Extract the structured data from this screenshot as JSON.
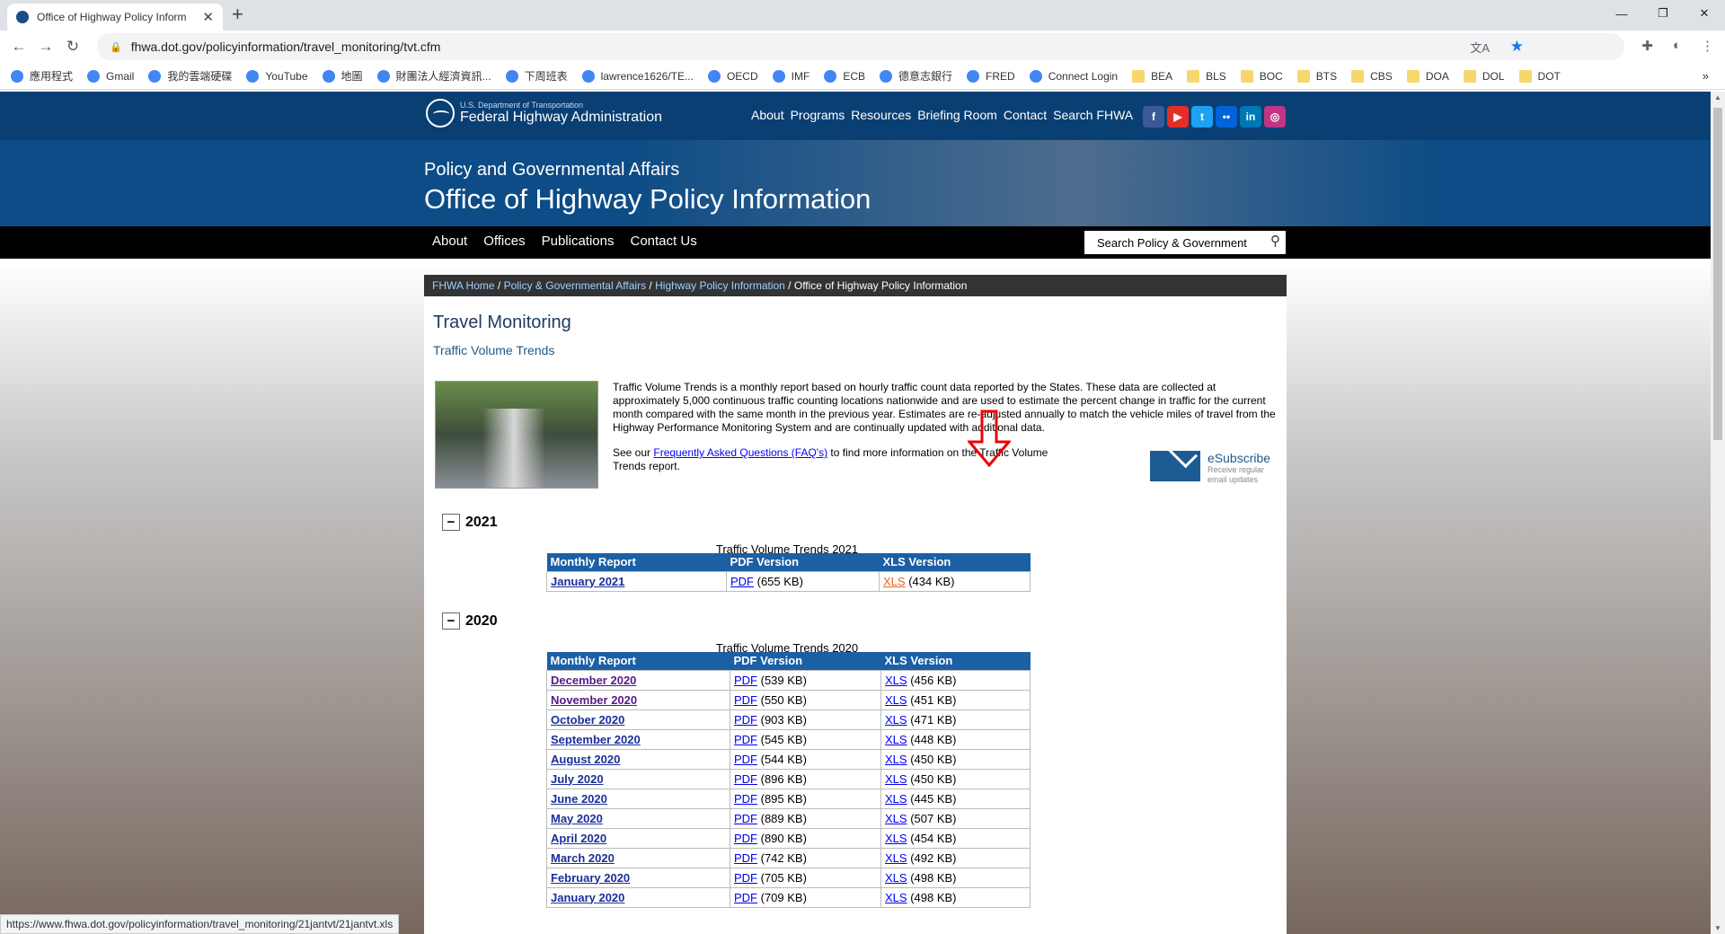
{
  "browser": {
    "tab_title": "Office of Highway Policy Inform",
    "url": "fhwa.dot.gov/policyinformation/travel_monitoring/tvt.cfm",
    "bookmarks": [
      "應用程式",
      "Gmail",
      "我的雲端硬碟",
      "YouTube",
      "地圖",
      "財團法人經濟資訊...",
      "下周班表",
      "lawrence1626/TE...",
      "OECD",
      "IMF",
      "ECB",
      "德意志銀行",
      "FRED",
      "Connect Login",
      "BEA",
      "BLS",
      "BOC",
      "BTS",
      "CBS",
      "DOA",
      "DOL",
      "DOT"
    ],
    "status_url": "https://www.fhwa.dot.gov/policyinformation/travel_monitoring/21jantvt/21jantvt.xls"
  },
  "header": {
    "agency_line1": "U.S. Department of Transportation",
    "agency_line2": "Federal Highway Administration",
    "nav": [
      "About",
      "Programs",
      "Resources",
      "Briefing Room",
      "Contact",
      "Search FHWA"
    ],
    "social": [
      {
        "label": "f",
        "color": "#3b5998"
      },
      {
        "label": "▶",
        "color": "#e52d27"
      },
      {
        "label": "t",
        "color": "#1da1f2"
      },
      {
        "label": "••",
        "color": "#0063dc"
      },
      {
        "label": "in",
        "color": "#0077b5"
      },
      {
        "label": "◎",
        "color": "#c13584"
      }
    ],
    "banner_sub": "Policy and Governmental Affairs",
    "banner_title": "Office of Highway Policy Information",
    "subnav": [
      "About",
      "Offices",
      "Publications",
      "Contact Us"
    ],
    "search_placeholder": "Search Policy & Government"
  },
  "breadcrumb": {
    "links": [
      "FHWA Home",
      "Policy & Governmental Affairs",
      "Highway Policy Information"
    ],
    "current": "Office of Highway Policy Information"
  },
  "main": {
    "title": "Travel Monitoring",
    "subtitle": "Traffic Volume Trends",
    "intro": "Traffic Volume Trends is a monthly report based on hourly traffic count data reported by the States. These data are collected at approximately 5,000 continuous traffic counting locations nationwide and are used to estimate the percent change in traffic for the current month compared with the same month in the previous year. Estimates are re-adjusted annually to match the vehicle miles of travel from the Highway Performance Monitoring System and are continually updated with additional data.",
    "faq_pre": "See our ",
    "faq_link": "Frequently Asked Questions (FAQ's)",
    "faq_post": " to find more information on the Traffic Volume Trends report.",
    "esubscribe": "eSubscribe",
    "esubscribe_sub": "Receive regular email updates"
  },
  "sections": [
    {
      "year": "2021",
      "caption": "Traffic Volume Trends 2021",
      "headers": [
        "Monthly Report",
        "PDF Version",
        "XLS Version"
      ],
      "rows": [
        {
          "month": "January 2021",
          "pdf": "PDF",
          "pdf_size": " (655 KB)",
          "xls": "XLS",
          "xls_size": " (434 KB)"
        }
      ]
    },
    {
      "year": "2020",
      "caption": "Traffic Volume Trends 2020",
      "headers": [
        "Monthly Report",
        "PDF Version",
        "XLS Version"
      ],
      "rows": [
        {
          "month": "December 2020",
          "pdf": "PDF",
          "pdf_size": " (539 KB)",
          "xls": "XLS",
          "xls_size": " (456 KB)"
        },
        {
          "month": "November 2020",
          "pdf": "PDF",
          "pdf_size": " (550 KB)",
          "xls": "XLS",
          "xls_size": " (451 KB)"
        },
        {
          "month": "October 2020",
          "pdf": "PDF",
          "pdf_size": " (903 KB)",
          "xls": "XLS",
          "xls_size": " (471 KB)"
        },
        {
          "month": "September 2020",
          "pdf": "PDF",
          "pdf_size": " (545 KB)",
          "xls": "XLS",
          "xls_size": " (448 KB)"
        },
        {
          "month": "August 2020",
          "pdf": "PDF",
          "pdf_size": " (544 KB)",
          "xls": "XLS",
          "xls_size": " (450 KB)"
        },
        {
          "month": "July 2020",
          "pdf": "PDF",
          "pdf_size": " (896 KB)",
          "xls": "XLS",
          "xls_size": " (450 KB)"
        },
        {
          "month": "June 2020",
          "pdf": "PDF",
          "pdf_size": " (895 KB)",
          "xls": "XLS",
          "xls_size": " (445 KB)"
        },
        {
          "month": "May 2020",
          "pdf": "PDF",
          "pdf_size": " (889 KB)",
          "xls": "XLS",
          "xls_size": " (507 KB)"
        },
        {
          "month": "April 2020",
          "pdf": "PDF",
          "pdf_size": " (890 KB)",
          "xls": "XLS",
          "xls_size": " (454 KB)"
        },
        {
          "month": "March 2020",
          "pdf": "PDF",
          "pdf_size": " (742 KB)",
          "xls": "XLS",
          "xls_size": " (492 KB)"
        },
        {
          "month": "February 2020",
          "pdf": "PDF",
          "pdf_size": " (705 KB)",
          "xls": "XLS",
          "xls_size": " (498 KB)"
        },
        {
          "month": "January 2020",
          "pdf": "PDF",
          "pdf_size": " (709 KB)",
          "xls": "XLS",
          "xls_size": " (498 KB)"
        }
      ]
    }
  ]
}
